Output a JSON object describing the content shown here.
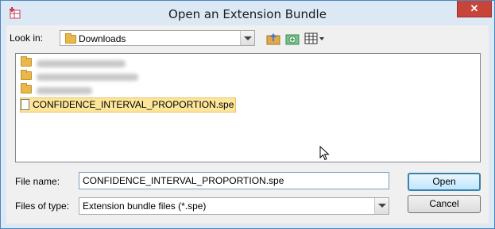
{
  "window": {
    "title": "Open an Extension Bundle",
    "close_glyph": "✕"
  },
  "lookin": {
    "label": "Look in:",
    "value": "Downloads"
  },
  "toolbar": {
    "icons": [
      "up-folder-icon",
      "new-folder-icon",
      "view-menu-icon"
    ]
  },
  "files": {
    "selected_item": "CONFIDENCE_INTERVAL_PROPORTION.spe"
  },
  "filename": {
    "label": "File name:",
    "value": "CONFIDENCE_INTERVAL_PROPORTION.spe"
  },
  "filetype": {
    "label": "Files of type:",
    "value": "Extension bundle files (*.spe)"
  },
  "buttons": {
    "open": "Open",
    "cancel": "Cancel"
  },
  "colors": {
    "selection": "#fde69b",
    "title_bg": "#dce9f5",
    "close": "#c7443a"
  }
}
